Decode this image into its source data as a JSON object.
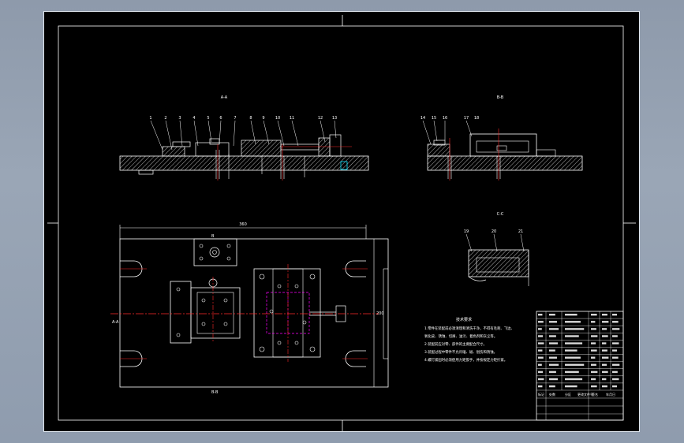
{
  "colors": {
    "background": "#000000",
    "line": "#ffffff",
    "centerline": "#ff2a2a",
    "highlight": "#ff00ff",
    "viewport_border": "#dfe6ee"
  },
  "views": {
    "main_section": {
      "title": "A-A",
      "part_numbers": [
        "1",
        "2",
        "3",
        "4",
        "5",
        "6",
        "7",
        "8",
        "9",
        "10",
        "11",
        "12",
        "13"
      ]
    },
    "side_section": {
      "title": "B-B",
      "part_numbers": [
        "14",
        "15",
        "16",
        "17",
        "18"
      ]
    },
    "detail_section": {
      "title": "C-C",
      "part_numbers": [
        "19",
        "20",
        "21"
      ]
    },
    "plan_view": {
      "top_dimension": "360",
      "left_label": "A-A",
      "bottom_label": "B-B",
      "right_dimension": "200",
      "top_cut_label": "B"
    }
  },
  "technical_requirements": {
    "title": "技术要求",
    "lines": [
      "1.零件在装配前必须清理和清洗干净，不得有毛刺、飞边、",
      "氧化皮、锈蚀、切屑、油污、着色剂和灰尘等。",
      "2.装配前应对零、部件的主要配合尺寸。",
      "3.装配过程中零件不允许磕、碰、划伤和锈蚀。",
      "4.螺钉紧固时必须使用力矩扳手，并按规定力矩拧紧。"
    ]
  },
  "title_block": {
    "rows": 11,
    "bottom_labels": [
      "标记",
      "处数",
      "分区",
      "更改文件号",
      "签名",
      "年月日"
    ]
  }
}
